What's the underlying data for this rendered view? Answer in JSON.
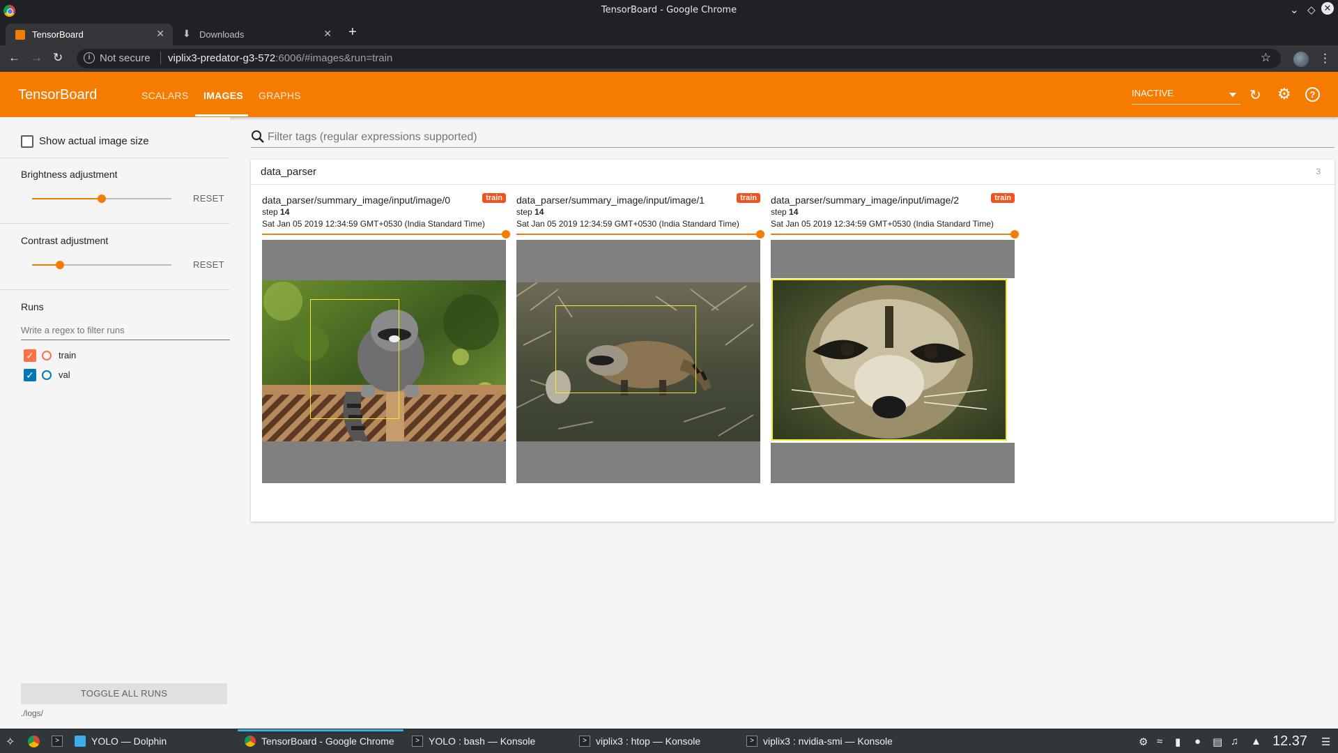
{
  "window": {
    "title": "TensorBoard - Google Chrome"
  },
  "browser": {
    "tabs": [
      {
        "label": "TensorBoard",
        "active": true
      },
      {
        "label": "Downloads",
        "active": false
      }
    ],
    "omnibox": {
      "security": "Not secure",
      "host": "viplix3-predator-g3-572",
      "path": ":6006/#images&run=train"
    }
  },
  "tensorboard": {
    "brand": "TensorBoard",
    "nav": [
      "SCALARS",
      "IMAGES",
      "GRAPHS"
    ],
    "active_nav": "IMAGES",
    "status_select": "INACTIVE",
    "accent": "#f57c00"
  },
  "sidebar": {
    "show_actual_size": "Show actual image size",
    "brightness": {
      "label": "Brightness adjustment",
      "reset": "RESET",
      "level": 0.5
    },
    "contrast": {
      "label": "Contrast adjustment",
      "reset": "RESET",
      "level": 0.2
    },
    "runs": {
      "heading": "Runs",
      "filter_placeholder": "Write a regex to filter runs",
      "items": [
        {
          "name": "train",
          "color": "#ff7043",
          "checked": true
        },
        {
          "name": "val",
          "color": "#0077bb",
          "checked": true
        }
      ]
    },
    "toggle_all": "TOGGLE ALL RUNS",
    "logdir": "./logs/"
  },
  "main": {
    "filter_placeholder": "Filter tags (regular expressions supported)",
    "category": {
      "title": "data_parser",
      "count": "3"
    },
    "cards": [
      {
        "tag": "data_parser/summary_image/input/image/0",
        "run": "train",
        "step_label": "step",
        "step": "14",
        "date": "Sat Jan 05 2019 12:34:59 GMT+0530 (India Standard Time)",
        "image": "raccoon-on-fence"
      },
      {
        "tag": "data_parser/summary_image/input/image/1",
        "run": "train",
        "step_label": "step",
        "step": "14",
        "date": "Sat Jan 05 2019 12:34:59 GMT+0530 (India Standard Time)",
        "image": "raccoon-on-ground"
      },
      {
        "tag": "data_parser/summary_image/input/image/2",
        "run": "train",
        "step_label": "step",
        "step": "14",
        "date": "Sat Jan 05 2019 12:34:59 GMT+0530 (India Standard Time)",
        "image": "raccoon-face-closeup"
      }
    ]
  },
  "taskbar": {
    "tasks": [
      {
        "label": "YOLO — Dolphin",
        "icon": "folder-icon"
      },
      {
        "label": "TensorBoard - Google Chrome",
        "icon": "chrome-icon",
        "active": true
      },
      {
        "label": "YOLO : bash — Konsole",
        "icon": "terminal-icon"
      },
      {
        "label": "viplix3 : htop — Konsole",
        "icon": "terminal-icon"
      },
      {
        "label": "viplix3 : nvidia-smi — Konsole",
        "icon": "terminal-icon"
      }
    ],
    "clock": "12.37"
  }
}
